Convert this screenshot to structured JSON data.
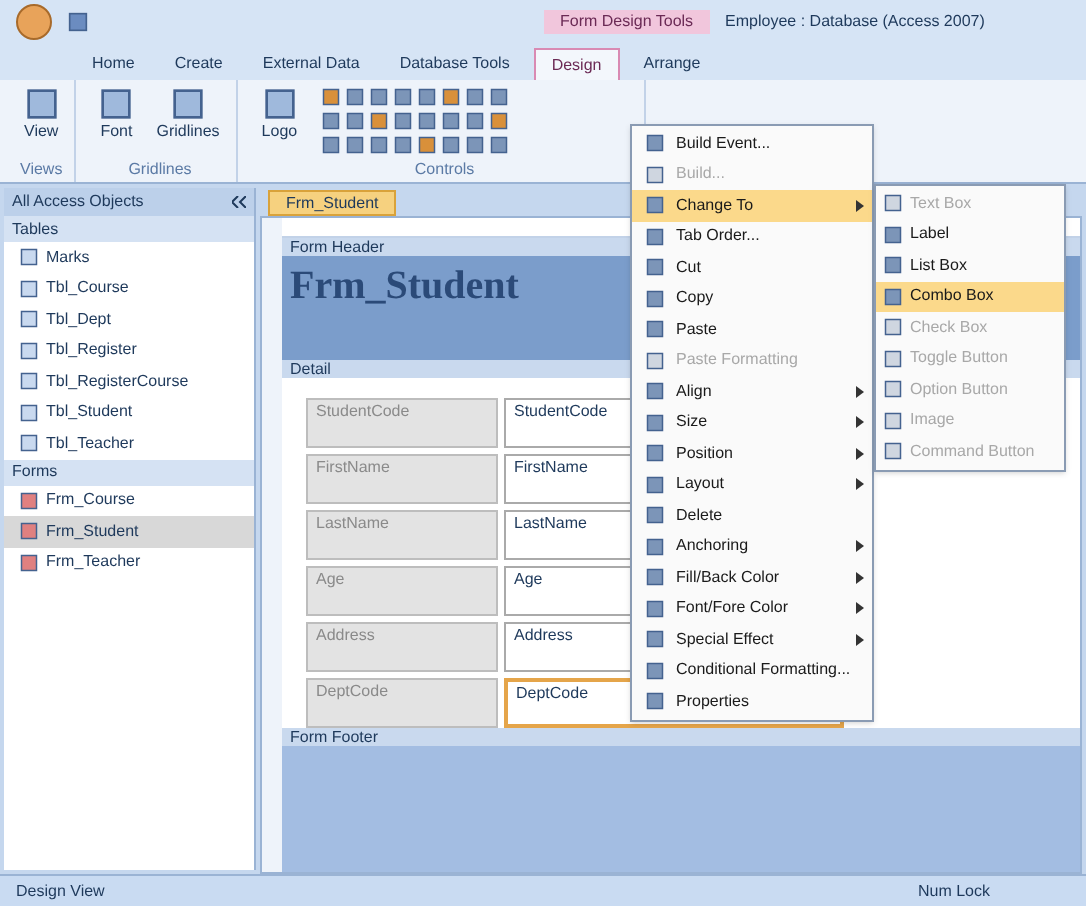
{
  "window": {
    "title": "Employee : Database (Access 2007)",
    "contextual_group": "Form Design Tools"
  },
  "ribbon": {
    "tabs": [
      {
        "label": "Home",
        "selected": false
      },
      {
        "label": "Create",
        "selected": false
      },
      {
        "label": "External Data",
        "selected": false
      },
      {
        "label": "Database Tools",
        "selected": false
      },
      {
        "label": "Design",
        "selected": true
      },
      {
        "label": "Arrange",
        "selected": false
      }
    ],
    "groups": [
      {
        "label": "Views",
        "buttons": [
          "View"
        ]
      },
      {
        "label": "Gridlines",
        "buttons": [
          "Font",
          "Gridlines"
        ]
      },
      {
        "label": "Controls",
        "buttons": [
          "Logo"
        ]
      }
    ]
  },
  "nav_pane": {
    "title": "All Access Objects",
    "sections": [
      {
        "title": "Tables",
        "kind": "table",
        "items": [
          {
            "label": "Marks",
            "selected": false
          },
          {
            "label": "Tbl_Course",
            "selected": false
          },
          {
            "label": "Tbl_Dept",
            "selected": false
          },
          {
            "label": "Tbl_Register",
            "selected": false
          },
          {
            "label": "Tbl_RegisterCourse",
            "selected": false
          },
          {
            "label": "Tbl_Student",
            "selected": false
          },
          {
            "label": "Tbl_Teacher",
            "selected": false
          }
        ]
      },
      {
        "title": "Forms",
        "kind": "form",
        "items": [
          {
            "label": "Frm_Course",
            "selected": false
          },
          {
            "label": "Frm_Student",
            "selected": true
          },
          {
            "label": "Frm_Teacher",
            "selected": false
          }
        ]
      }
    ]
  },
  "document_tab": {
    "label": "Frm_Student"
  },
  "form": {
    "header_bar": "Form Header",
    "title": "Frm_Student",
    "detail_bar": "Detail",
    "footer_bar": "Form Footer",
    "fields": [
      {
        "label": "StudentCode",
        "value": "StudentCode",
        "selected": false
      },
      {
        "label": "FirstName",
        "value": "FirstName",
        "selected": false
      },
      {
        "label": "LastName",
        "value": "LastName",
        "selected": false
      },
      {
        "label": "Age",
        "value": "Age",
        "selected": false
      },
      {
        "label": "Address",
        "value": "Address",
        "selected": false
      },
      {
        "label": "DeptCode",
        "value": "DeptCode",
        "selected": true
      }
    ]
  },
  "context_menu": [
    {
      "label": "Build Event...",
      "submenu": false,
      "disabled": false,
      "selected": false
    },
    {
      "label": "Build...",
      "submenu": false,
      "disabled": true,
      "selected": false
    },
    {
      "label": "Change To",
      "submenu": true,
      "disabled": false,
      "selected": true
    },
    {
      "label": "Tab Order...",
      "submenu": false,
      "disabled": false,
      "selected": false
    },
    {
      "label": "Cut",
      "submenu": false,
      "disabled": false,
      "selected": false
    },
    {
      "label": "Copy",
      "submenu": false,
      "disabled": false,
      "selected": false
    },
    {
      "label": "Paste",
      "submenu": false,
      "disabled": false,
      "selected": false
    },
    {
      "label": "Paste Formatting",
      "submenu": false,
      "disabled": true,
      "selected": false
    },
    {
      "label": "Align",
      "submenu": true,
      "disabled": false,
      "selected": false
    },
    {
      "label": "Size",
      "submenu": true,
      "disabled": false,
      "selected": false
    },
    {
      "label": "Position",
      "submenu": true,
      "disabled": false,
      "selected": false
    },
    {
      "label": "Layout",
      "submenu": true,
      "disabled": false,
      "selected": false
    },
    {
      "label": "Delete",
      "submenu": false,
      "disabled": false,
      "selected": false
    },
    {
      "label": "Anchoring",
      "submenu": true,
      "disabled": false,
      "selected": false
    },
    {
      "label": "Fill/Back Color",
      "submenu": true,
      "disabled": false,
      "selected": false
    },
    {
      "label": "Font/Fore Color",
      "submenu": true,
      "disabled": false,
      "selected": false
    },
    {
      "label": "Special Effect",
      "submenu": true,
      "disabled": false,
      "selected": false
    },
    {
      "label": "Conditional Formatting...",
      "submenu": false,
      "disabled": false,
      "selected": false
    },
    {
      "label": "Properties",
      "submenu": false,
      "disabled": false,
      "selected": false
    }
  ],
  "submenu": [
    {
      "label": "Text Box",
      "disabled": true,
      "selected": false
    },
    {
      "label": "Label",
      "disabled": false,
      "selected": false
    },
    {
      "label": "List Box",
      "disabled": false,
      "selected": false
    },
    {
      "label": "Combo Box",
      "disabled": false,
      "selected": true
    },
    {
      "label": "Check Box",
      "disabled": true,
      "selected": false
    },
    {
      "label": "Toggle Button",
      "disabled": true,
      "selected": false
    },
    {
      "label": "Option Button",
      "disabled": true,
      "selected": false
    },
    {
      "label": "Image",
      "disabled": true,
      "selected": false
    },
    {
      "label": "Command Button",
      "disabled": true,
      "selected": false
    }
  ],
  "status_bar": {
    "left": "Design View",
    "right": "Num Lock"
  }
}
